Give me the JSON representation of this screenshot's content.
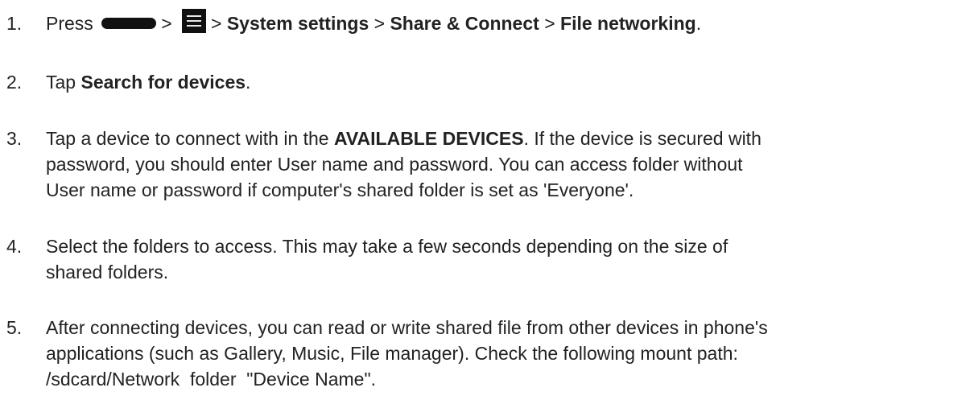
{
  "steps": [
    {
      "number": "1.",
      "press": "Press",
      "sep": ">",
      "home_key_icon": "home-key-icon",
      "menu_key_icon": "menu-key-icon",
      "system_settings": "System settings",
      "share_connect": "Share & Connect",
      "file_networking": "File networking",
      "end": "."
    },
    {
      "number": "2.",
      "tap": "Tap",
      "search": "Search for devices",
      "end": "."
    },
    {
      "number": "3.",
      "before": "Tap a device to connect with in the",
      "available": "AVAILABLE DEVICES",
      "line1_rest": ". If the device is secured with",
      "line2": "password, you should enter User name and password. You can access folder without",
      "line3": "User name or password if computer's shared folder is set as 'Everyone'."
    },
    {
      "number": "4.",
      "line1": "Select the folders to access. This may take a few seconds depending on the size of",
      "line2": "shared folders."
    },
    {
      "number": "5.",
      "line1": "After connecting devices, you can read or write shared file from other devices in phone's",
      "line2": "applications (such as Gallery, Music, File manager). Check the following mount path:",
      "line3": "/sdcard/Network  folder  \"Device Name\"."
    }
  ]
}
